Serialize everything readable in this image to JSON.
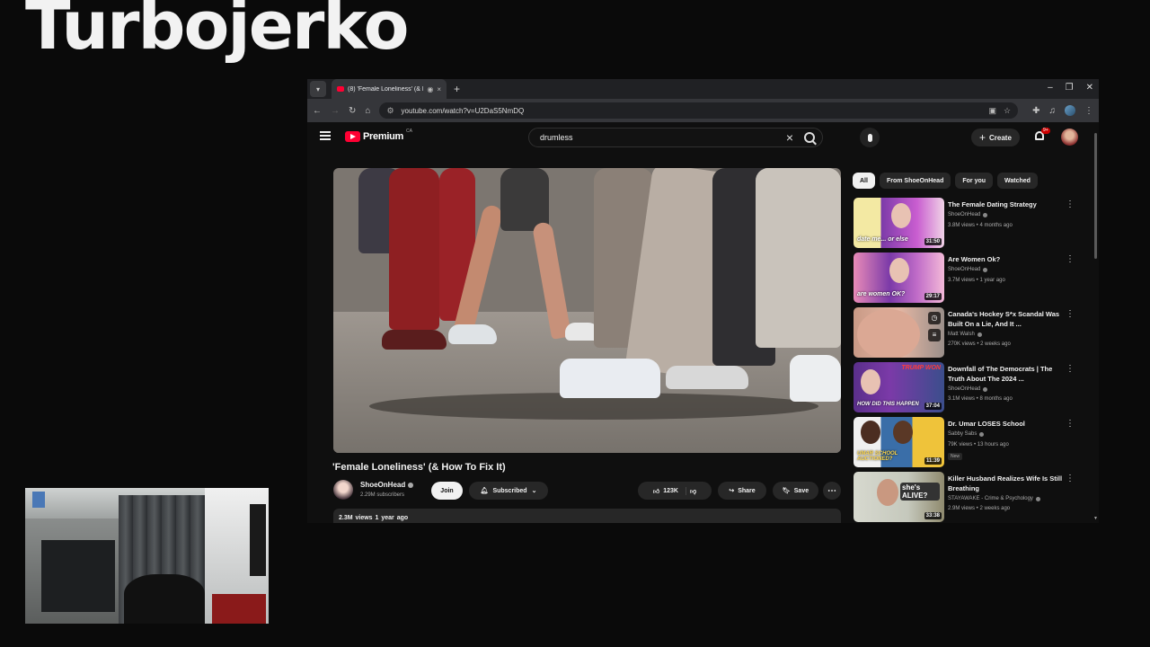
{
  "overlay": {
    "title": "Turbojerko"
  },
  "browser": {
    "tab_title": "(8) 'Female Loneliness' (& H",
    "url": "youtube.com/watch?v=U2DaS5NmDQ"
  },
  "youtube": {
    "logo_text": "Premium",
    "logo_region": "CA",
    "search_value": "drumless",
    "create_label": "Create",
    "notification_count": "9+",
    "video": {
      "title": "'Female Loneliness' (& How To Fix It)",
      "channel": "ShoeOnHead",
      "subscribers": "2.29M subscribers",
      "join_label": "Join",
      "subscribed_label": "Subscribed",
      "likes": "123K",
      "share_label": "Share",
      "save_label": "Save",
      "views": "2.3M views",
      "age": "1 year ago"
    },
    "chips": [
      "All",
      "From ShoeOnHead",
      "For you",
      "Watched"
    ],
    "recommendations": [
      {
        "title": "The Female Dating Strategy",
        "channel": "ShoeOnHead",
        "meta": "3.8M views • 4 months ago",
        "duration": "31:50",
        "thumb_text": "date me... or else"
      },
      {
        "title": "Are Women Ok?",
        "channel": "ShoeOnHead",
        "meta": "3.7M views • 1 year ago",
        "duration": "29:17",
        "thumb_text": "are women OK?"
      },
      {
        "title": "Canada's Hockey S*x Scandal Was Built On a Lie, And It ...",
        "channel": "Matt Walsh",
        "meta": "270K views • 2 weeks ago",
        "duration": "",
        "thumb_text": ""
      },
      {
        "title": "Downfall of The Democrats | The Truth About The 2024 ...",
        "channel": "ShoeOnHead",
        "meta": "3.1M views • 8 months ago",
        "duration": "37:04",
        "thumb_text": "HOW DID THIS HAPPEN",
        "thumb_text_top": "TRUMP WON"
      },
      {
        "title": "Dr. Umar LOSES School",
        "channel": "Sabby Sabs",
        "meta": "79K views • 13 hours ago",
        "duration": "11:39",
        "badge": "New",
        "thumb_text": "UMAR SCHOOL AUCTIONED?"
      },
      {
        "title": "Killer Husband Realizes Wife Is Still Breathing",
        "channel": "STAYAWAKE - Crime & Psychology",
        "meta": "2.9M views • 2 weeks ago",
        "duration": "33:38",
        "thumb_text": "she's ALIVE?"
      }
    ]
  }
}
